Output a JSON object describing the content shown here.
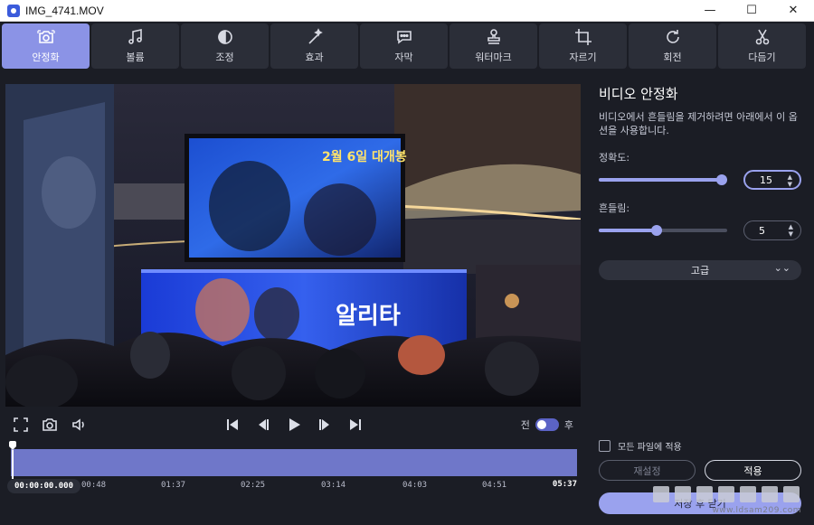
{
  "window": {
    "title": "IMG_4741.MOV",
    "minimize": "—",
    "maximize": "☐",
    "close": "✕"
  },
  "tabs": [
    {
      "label": "안정화",
      "icon": "stabilize-camera-icon",
      "active": true
    },
    {
      "label": "볼륨",
      "icon": "music-note-icon",
      "active": false
    },
    {
      "label": "조정",
      "icon": "contrast-icon",
      "active": false
    },
    {
      "label": "효과",
      "icon": "magic-wand-icon",
      "active": false
    },
    {
      "label": "자막",
      "icon": "speech-bubble-icon",
      "active": false
    },
    {
      "label": "워터마크",
      "icon": "stamp-icon",
      "active": false
    },
    {
      "label": "자르기",
      "icon": "crop-icon",
      "active": false
    },
    {
      "label": "회전",
      "icon": "rotate-icon",
      "active": false
    },
    {
      "label": "다듬기",
      "icon": "scissors-icon",
      "active": false
    }
  ],
  "preview": {
    "screen_text": "2월 6일 대개봉",
    "stage_text": "알리타"
  },
  "controls": {
    "before_label": "전",
    "after_label": "후"
  },
  "timeline": {
    "current": "00:00:00.000",
    "ticks": [
      "00:48",
      "01:37",
      "02:25",
      "03:14",
      "04:03",
      "04:51"
    ],
    "end": "05:37"
  },
  "panel": {
    "title": "비디오 안정화",
    "description": "비디오에서 흔들림을 제거하려면 아래에서 이 옵션을 사용합니다.",
    "accuracy_label": "정확도:",
    "accuracy_value": "15",
    "accuracy_level": 0.96,
    "shake_label": "흔들림:",
    "shake_value": "5",
    "shake_level": 0.45,
    "advanced_label": "고급",
    "apply_all_label": "모든 파일에 적용",
    "reset_label": "재설정",
    "apply_label": "적용",
    "save_label": "저장 후 닫기"
  },
  "watermark": {
    "text": "www.ldsam209.com"
  },
  "colors": {
    "accent": "#8b93e6",
    "background": "#1b1d25",
    "tab_bg": "#2b2e38",
    "timeline": "#6f77c9"
  }
}
